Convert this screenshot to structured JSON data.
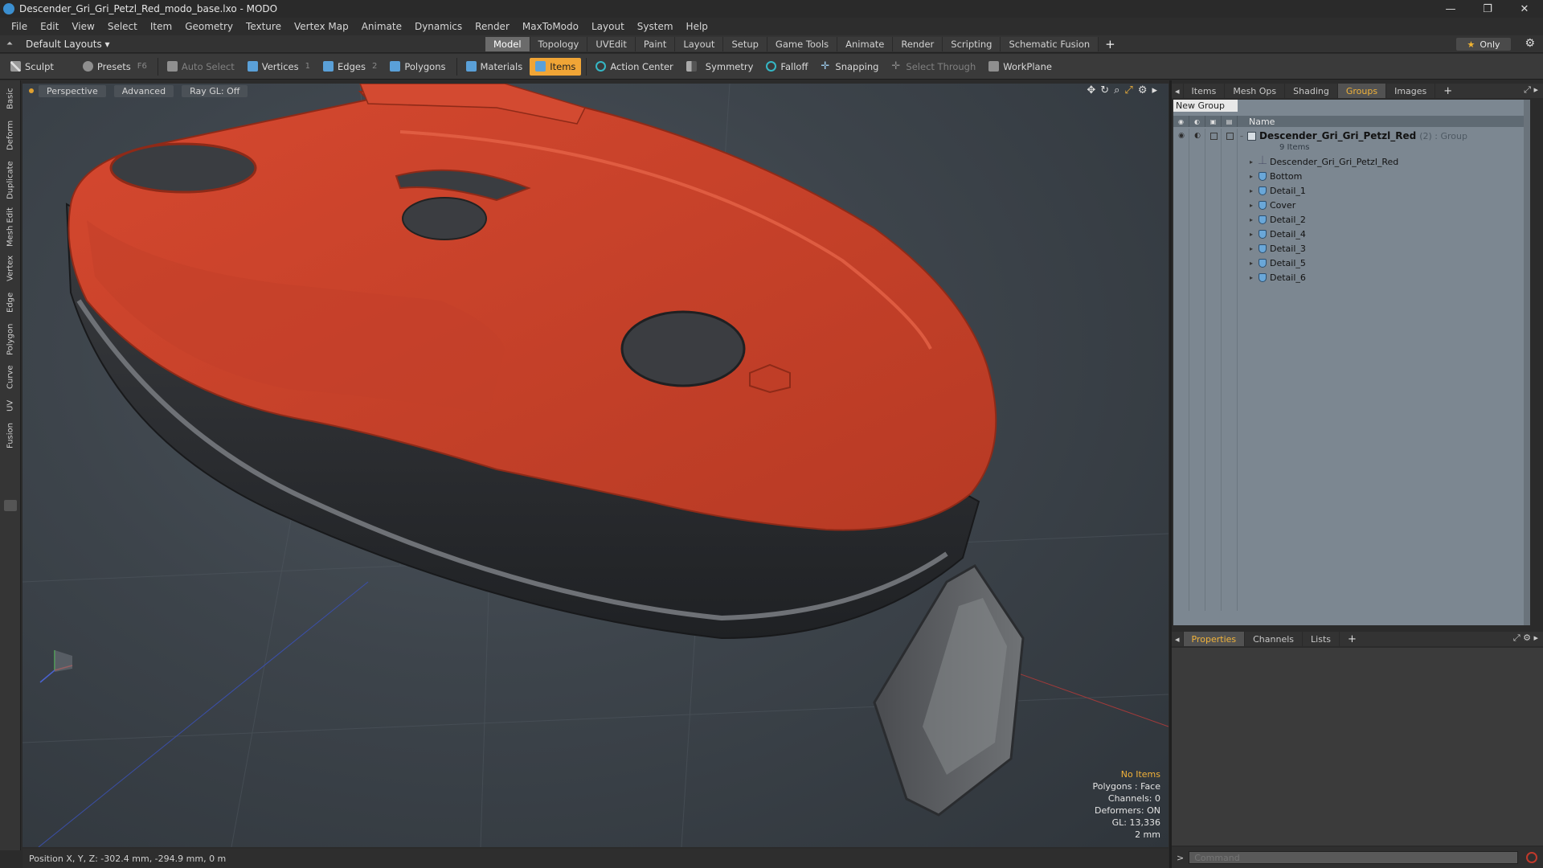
{
  "window": {
    "title": "Descender_Gri_Gri_Petzl_Red_modo_base.lxo - MODO",
    "controls": [
      "—",
      "❐",
      "✕"
    ]
  },
  "menubar": [
    "File",
    "Edit",
    "View",
    "Select",
    "Item",
    "Geometry",
    "Texture",
    "Vertex Map",
    "Animate",
    "Dynamics",
    "Render",
    "MaxToModo",
    "Layout",
    "System",
    "Help"
  ],
  "layoutbar": {
    "dropdown": "Default Layouts ▾",
    "tabs": [
      "Model",
      "Topology",
      "UVEdit",
      "Paint",
      "Layout",
      "Setup",
      "Game Tools",
      "Animate",
      "Render",
      "Scripting",
      "Schematic Fusion"
    ],
    "active_tab": "Model",
    "plus": "+",
    "only_label": "Only"
  },
  "toolbar": {
    "sculpt": "Sculpt",
    "presets": "Presets",
    "presets_hotkey": "F6",
    "auto_select": "Auto Select",
    "vertices": "Vertices",
    "vertices_count": "1",
    "edges": "Edges",
    "edges_count": "2",
    "polygons": "Polygons",
    "materials": "Materials",
    "items": "Items",
    "action_center": "Action Center",
    "symmetry": "Symmetry",
    "falloff": "Falloff",
    "snapping": "Snapping",
    "select_through": "Select Through",
    "workplane": "WorkPlane"
  },
  "left_tabs": [
    "Basic",
    "Deform",
    "Duplicate",
    "Mesh Edit",
    "Vertex",
    "Edge",
    "Polygon",
    "Curve",
    "UV",
    "Fusion"
  ],
  "viewport": {
    "view_mode": "Perspective",
    "shading": "Advanced",
    "raygl": "Ray GL: Off",
    "stats": {
      "selection": "No Items",
      "polygons": "Polygons : Face",
      "channels": "Channels: 0",
      "deformers": "Deformers: ON",
      "gl": "GL: 13,336",
      "scale": "2 mm"
    },
    "colors": {
      "body_red": "#c9432c",
      "body_dark": "#2c2e31",
      "accent": "#f2b23a"
    }
  },
  "statusbar": {
    "position": "Position X, Y, Z:  -302.4 mm, -294.9 mm, 0 m"
  },
  "right_panel": {
    "tabs": [
      "Items",
      "Mesh Ops",
      "Shading",
      "Groups",
      "Images"
    ],
    "active_tab": "Groups",
    "new_group": "New Group",
    "name_header": "Name",
    "group": {
      "name": "Descender_Gri_Gri_Petzl_Red",
      "suffix": "(2) : Group",
      "count": "9 Items"
    },
    "items": [
      "Descender_Gri_Gri_Petzl_Red",
      "Bottom",
      "Detail_1",
      "Cover",
      "Detail_2",
      "Detail_4",
      "Detail_3",
      "Detail_5",
      "Detail_6"
    ]
  },
  "props_panel": {
    "tabs": [
      "Properties",
      "Channels",
      "Lists"
    ],
    "active_tab": "Properties"
  },
  "command": {
    "placeholder": "Command"
  }
}
